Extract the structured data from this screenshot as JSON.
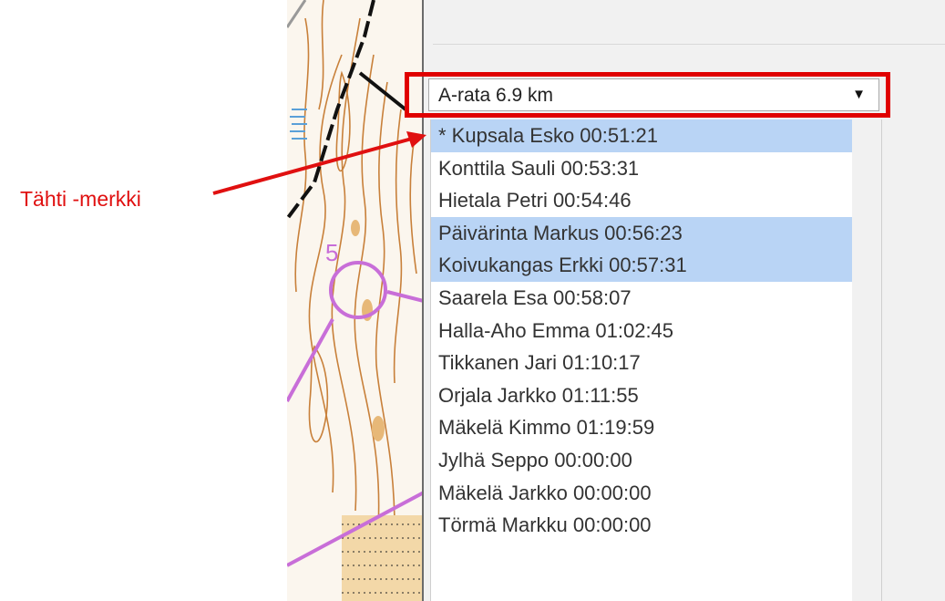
{
  "map": {
    "control_number": "5",
    "colors": {
      "course": "#c86ed8",
      "contour": "#c8803a",
      "track": "#111111"
    }
  },
  "course_select": {
    "selected": "A-rata 6.9 km",
    "arrow": "▼"
  },
  "runners": [
    {
      "label": "* Kupsala Esko 00:51:21",
      "selected": true
    },
    {
      "label": "Konttila Sauli 00:53:31",
      "selected": false
    },
    {
      "label": "Hietala Petri 00:54:46",
      "selected": false
    },
    {
      "label": "Päivärinta Markus 00:56:23",
      "selected": true
    },
    {
      "label": "Koivukangas Erkki 00:57:31",
      "selected": true
    },
    {
      "label": "Saarela Esa 00:58:07",
      "selected": false
    },
    {
      "label": "Halla-Aho Emma 01:02:45",
      "selected": false
    },
    {
      "label": "Tikkanen Jari 01:10:17",
      "selected": false
    },
    {
      "label": "Orjala Jarkko 01:11:55",
      "selected": false
    },
    {
      "label": "Mäkelä Kimmo 01:19:59",
      "selected": false
    },
    {
      "label": "Jylhä Seppo 00:00:00",
      "selected": false
    },
    {
      "label": "Mäkelä Jarkko 00:00:00",
      "selected": false
    },
    {
      "label": "Törmä Markku 00:00:00",
      "selected": false
    }
  ],
  "annotation": {
    "text": "Tähti -merkki",
    "color": "#e01010"
  }
}
